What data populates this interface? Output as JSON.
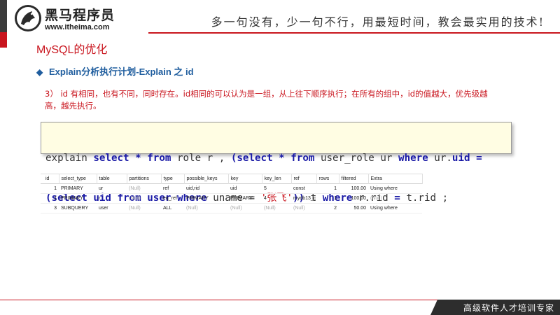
{
  "header": {
    "logo_name": "黑马程序员",
    "logo_url": "www.itheima.com",
    "slogan": "多一句没有，少一句不行，用最短时间，教会最实用的技术!"
  },
  "page_title": "MySQL的优化",
  "section_heading": "Explain分析执行计划-Explain 之 id",
  "paragraph": "3） id 有相同，也有不同，同时存在。id相同的可以认为是一组，从上往下顺序执行；在所有的组中，id的值越大，优先级越高，越先执行。",
  "code": {
    "line1": [
      {
        "t": "explain ",
        "k": false
      },
      {
        "t": "select",
        "k": true
      },
      {
        "t": " ",
        "k": false
      },
      {
        "t": "*",
        "k": true
      },
      {
        "t": " ",
        "k": false
      },
      {
        "t": "from",
        "k": true
      },
      {
        "t": " role r , ",
        "k": false
      },
      {
        "t": "(select",
        "k": true
      },
      {
        "t": " ",
        "k": false
      },
      {
        "t": "*",
        "k": true
      },
      {
        "t": " ",
        "k": false
      },
      {
        "t": "from",
        "k": true
      },
      {
        "t": " user_role ur ",
        "k": false
      },
      {
        "t": "where",
        "k": true
      },
      {
        "t": " ur.",
        "k": false
      },
      {
        "t": "uid =",
        "k": true
      }
    ],
    "line2": [
      {
        "t": "(select",
        "k": true
      },
      {
        "t": " ",
        "k": false
      },
      {
        "t": "uid",
        "k": true
      },
      {
        "t": " ",
        "k": false
      },
      {
        "t": "from",
        "k": true
      },
      {
        "t": " ",
        "k": false
      },
      {
        "t": "user",
        "k": true
      },
      {
        "t": " ",
        "k": false
      },
      {
        "t": "where",
        "k": true
      },
      {
        "t": " uname = ",
        "k": false
      },
      {
        "t": "'张飞'",
        "s": true
      },
      {
        "t": "))",
        "k": true
      },
      {
        "t": " t ",
        "k": false
      },
      {
        "t": "where",
        "k": true
      },
      {
        "t": " r.rid ",
        "k": false
      },
      {
        "t": "=",
        "k": true
      },
      {
        "t": " t.rid ;",
        "k": false
      }
    ]
  },
  "result_table": {
    "columns": [
      "id",
      "select_type",
      "table",
      "partitions",
      "type",
      "possible_keys",
      "key",
      "key_len",
      "ref",
      "rows",
      "filtered",
      "Extra"
    ],
    "rows": [
      [
        "1",
        "PRIMARY",
        "ur",
        "(Null)",
        "ref",
        "uid,rid",
        "uid",
        "5",
        "const",
        "1",
        "100.00",
        "Using where"
      ],
      [
        "1",
        "PRIMARY",
        "r",
        "(Null)",
        "eq_ref",
        "PRIMARY",
        "PRIMARY",
        "4",
        "mydb13_c",
        "1",
        "100.00",
        "(Null)"
      ],
      [
        "3",
        "SUBQUERY",
        "user",
        "(Null)",
        "ALL",
        "(Null)",
        "(Null)",
        "(Null)",
        "(Null)",
        "2",
        "50.00",
        "Using where"
      ]
    ]
  },
  "footer": {
    "text": "高级软件人才培训专家"
  },
  "colors": {
    "accent_red": "#c9151e",
    "heading_blue": "#1f5d9e",
    "code_bg": "#fffde3",
    "keyword": "#1a1aa6"
  }
}
